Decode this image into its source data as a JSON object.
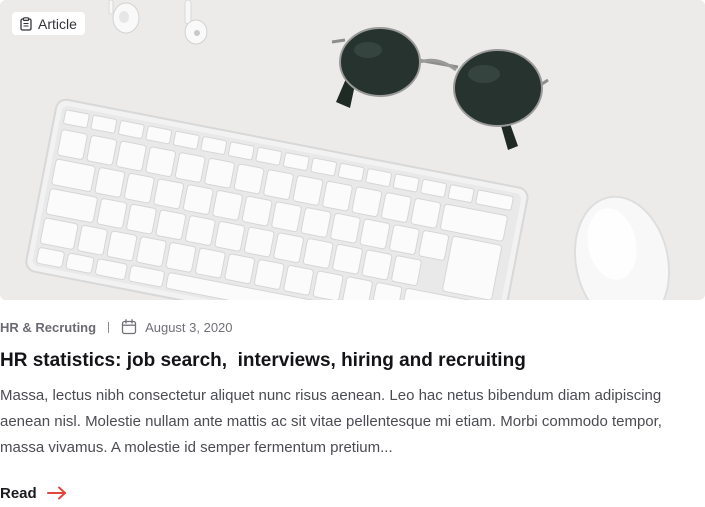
{
  "badge": {
    "label": "Article",
    "icon": "clipboard-icon"
  },
  "meta": {
    "category": "HR & Recruting",
    "date": "August 3, 2020",
    "date_icon": "calendar-icon"
  },
  "post": {
    "title": "HR statistics: job search,  interviews, hiring and recruiting",
    "excerpt": "Massa, lectus nibh consectetur aliquet nunc risus aenean. Leo hac netus bibendum diam adipiscing aenean nisl. Molestie nullam ante mattis ac sit vitae pellentesque mi etiam. Morbi commodo tempor, massa vivamus. A molestie id semper fermentum pretium..."
  },
  "read_link": {
    "label": "Read",
    "icon": "arrow-right-icon"
  },
  "colors": {
    "accent": "#e0463b",
    "text": "#1b1b1f",
    "muted": "#6f7077",
    "hero_background": "#ecebe9"
  }
}
